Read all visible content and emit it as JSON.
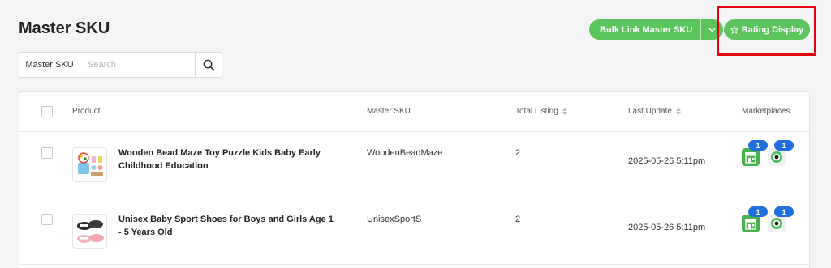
{
  "page": {
    "title": "Master SKU"
  },
  "search": {
    "label": "Master SKU",
    "placeholder": "Search"
  },
  "toolbar": {
    "bulk_link_label": "Bulk Link Master SKU",
    "rating_display_label": "Rating Display"
  },
  "colors": {
    "accent_green": "#5bc45c",
    "badge_blue": "#1f6fde",
    "highlight_red": "#e60012"
  },
  "table": {
    "headers": {
      "product": "Product",
      "master_sku": "Master SKU",
      "total_listing": "Total Listing",
      "last_update": "Last Update",
      "marketplaces": "Marketplaces"
    },
    "rows": [
      {
        "product": "Wooden Bead Maze Toy Puzzle Kids Baby Early Childhood Education",
        "master_sku": "WoodenBeadMaze",
        "total_listing": "2",
        "last_update": "2025-05-26 5:11pm",
        "marketplaces": [
          {
            "icon": "shop-green-icon",
            "count": "1"
          },
          {
            "icon": "shop-eye-icon",
            "count": "1"
          }
        ]
      },
      {
        "product": "Unisex Baby Sport Shoes for Boys and Girls Age 1 - 5 Years Old",
        "master_sku": "UnisexSportS",
        "total_listing": "2",
        "last_update": "2025-05-26 5:11pm",
        "marketplaces": [
          {
            "icon": "shop-green-icon",
            "count": "1"
          },
          {
            "icon": "shop-eye-icon",
            "count": "1"
          }
        ]
      }
    ]
  }
}
